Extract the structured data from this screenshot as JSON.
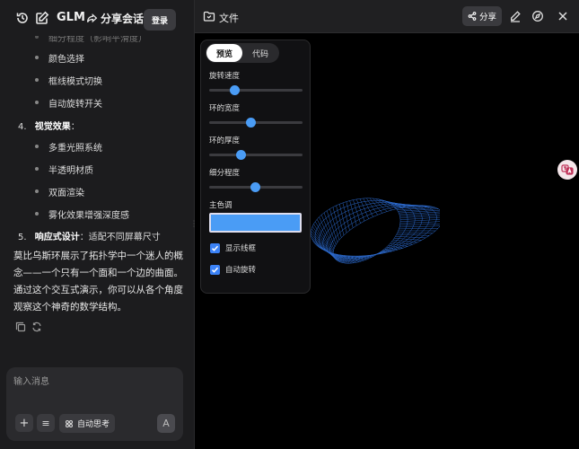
{
  "topbar": {
    "title": "GLM",
    "share_convo_label": "分享会话",
    "login_label": "登录",
    "icons": [
      "history-icon",
      "new-chat-icon",
      "share-icon"
    ]
  },
  "chat": {
    "faded_item": "细分程度（影响平滑度）",
    "bullets_a": [
      "颜色选择",
      "框线模式切换",
      "自动旋转开关"
    ],
    "section4": {
      "num": "4.",
      "title": "视觉效果",
      "colon": "："
    },
    "bullets_b": [
      "多重光照系统",
      "半透明材质",
      "双面渲染",
      "雾化效果增强深度感"
    ],
    "section5": {
      "num": "5.",
      "title": "响应式设计",
      "desc": "：适配不同屏幕尺寸"
    },
    "summary": "莫比乌斯环展示了拓扑学中一个迷人的概念——一个只有一个面和一个边的曲面。通过这个交互式演示，你可以从各个角度观察这个神奇的数学结构。"
  },
  "composer": {
    "placeholder": "输入消息",
    "deep_think_label": "自动思考",
    "send_glyph": "A"
  },
  "file_panel": {
    "title": "文件",
    "share_label": "分享"
  },
  "controls": {
    "tab_preview": "预览",
    "tab_code": "代码",
    "sliders": [
      {
        "label": "旋转速度",
        "value": 0.27
      },
      {
        "label": "环的宽度",
        "value": 0.44
      },
      {
        "label": "环的厚度",
        "value": 0.34
      },
      {
        "label": "细分程度",
        "value": 0.49
      }
    ],
    "color_label": "主色调",
    "color_value": "#4a9cf5",
    "checkboxes": [
      {
        "label": "显示线框",
        "checked": true
      },
      {
        "label": "自动旋转",
        "checked": true
      }
    ]
  },
  "colors": {
    "accent": "#4a9cf5",
    "mesh": "#2f6fd6"
  }
}
